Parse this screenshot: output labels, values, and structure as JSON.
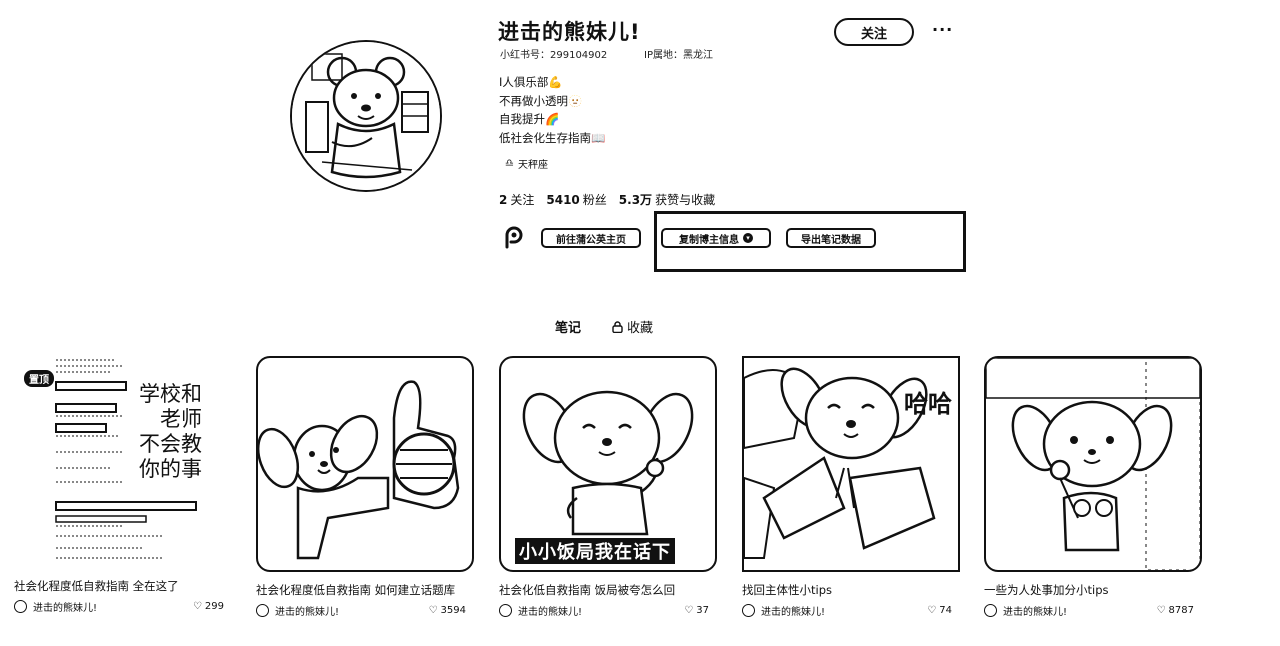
{
  "profile": {
    "nickname": "进击的熊妹儿!",
    "red_id": "小红书号：299104902",
    "ip": "IP属地：黑龙江",
    "bio": [
      "I人俱乐部💪",
      "不再做小透明🫥",
      "自我提升🌈",
      "低社会化生存指南📖"
    ],
    "tag": "天秤座",
    "stats": [
      {
        "value": "2",
        "label": "关注"
      },
      {
        "value": "5410",
        "label": "粉丝"
      },
      {
        "value": "5.3万",
        "label": "获赞与收藏"
      }
    ],
    "follow_label": "关注",
    "more_label": "···"
  },
  "toolbar": {
    "pgy_label": "前往蒲公英主页",
    "copy_label": "复制博主信息",
    "export_label": "导出笔记数据"
  },
  "tabs": [
    {
      "label": "笔记"
    },
    {
      "label": "收藏"
    }
  ],
  "notes": [
    {
      "title": "社会化程度低自救指南 全在这了",
      "author": "进击的熊妹儿!",
      "likes": "299",
      "badge": "置顶",
      "cover_text": [
        "学校和",
        "老师",
        "不会教",
        "你的事"
      ]
    },
    {
      "title": "社会化程度低自救指南 如何建立话题库",
      "author": "进击的熊妹儿!",
      "likes": "3594"
    },
    {
      "title": "社会化低自救指南 饭局被夸怎么回",
      "author": "进击的熊妹儿!",
      "likes": "37",
      "cover_text": [
        "小小饭局我在话下"
      ]
    },
    {
      "title": "找回主体性小tips",
      "author": "进击的熊妹儿!",
      "likes": "74",
      "cover_text": [
        "哈哈"
      ]
    },
    {
      "title": "一些为人处事加分小tips",
      "author": "进击的熊妹儿!",
      "likes": "8787"
    }
  ]
}
